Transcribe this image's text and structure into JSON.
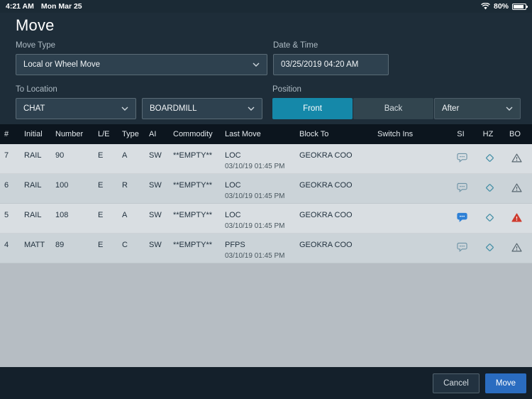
{
  "status_bar": {
    "time": "4:21 AM",
    "date": "Mon Mar 25",
    "battery_percent": "80%"
  },
  "page": {
    "title": "Move"
  },
  "form": {
    "move_type": {
      "label": "Move Type",
      "value": "Local or Wheel Move"
    },
    "date_time": {
      "label": "Date & Time",
      "value": "03/25/2019 04:20 AM"
    },
    "to_location": {
      "label": "To Location",
      "primary": "CHAT",
      "secondary": "BOARDMILL"
    },
    "position": {
      "label": "Position",
      "front": "Front",
      "back": "Back",
      "selected": "Front",
      "after": "After"
    }
  },
  "table": {
    "headers": [
      "#",
      "Initial",
      "Number",
      "L/E",
      "Type",
      "AI",
      "Commodity",
      "Last Move",
      "Block To",
      "Switch Ins",
      "SI",
      "HZ",
      "BO"
    ],
    "rows": [
      {
        "num": "7",
        "initial": "RAIL",
        "number": "90",
        "le": "E",
        "type": "A",
        "ai": "SW",
        "commodity": "**EMPTY**",
        "last_move": "LOC",
        "last_move_date": "03/10/19 01:45 PM",
        "block_to": "GEOKRA COO",
        "switch_ins": "",
        "si_class": "icon si",
        "hz_class": "icon hz",
        "bo_class": "icon bo"
      },
      {
        "num": "6",
        "initial": "RAIL",
        "number": "100",
        "le": "E",
        "type": "R",
        "ai": "SW",
        "commodity": "**EMPTY**",
        "last_move": "LOC",
        "last_move_date": "03/10/19 01:45 PM",
        "block_to": "GEOKRA COO",
        "switch_ins": "",
        "si_class": "icon si",
        "hz_class": "icon hz",
        "bo_class": "icon bo"
      },
      {
        "num": "5",
        "initial": "RAIL",
        "number": "108",
        "le": "E",
        "type": "A",
        "ai": "SW",
        "commodity": "**EMPTY**",
        "last_move": "LOC",
        "last_move_date": "03/10/19 01:45 PM",
        "block_to": "GEOKRA COO",
        "switch_ins": "",
        "si_class": "icon si filled",
        "hz_class": "icon hz",
        "bo_class": "icon bo alert"
      },
      {
        "num": "4",
        "initial": "MATT",
        "number": "89",
        "le": "E",
        "type": "C",
        "ai": "SW",
        "commodity": "**EMPTY**",
        "last_move": "PFPS",
        "last_move_date": "03/10/19 01:45 PM",
        "block_to": "GEOKRA COO",
        "switch_ins": "",
        "si_class": "icon si",
        "hz_class": "icon hz",
        "bo_class": "icon bo"
      }
    ]
  },
  "footer": {
    "cancel": "Cancel",
    "move": "Move"
  },
  "colors": {
    "accent_teal": "#1588a9",
    "primary_button_blue": "#2a6cc0",
    "alert_red": "#ce3b2e",
    "si_active_blue": "#2e80d6",
    "header_dark": "#0c151e",
    "background_dark": "#1e2d39"
  }
}
